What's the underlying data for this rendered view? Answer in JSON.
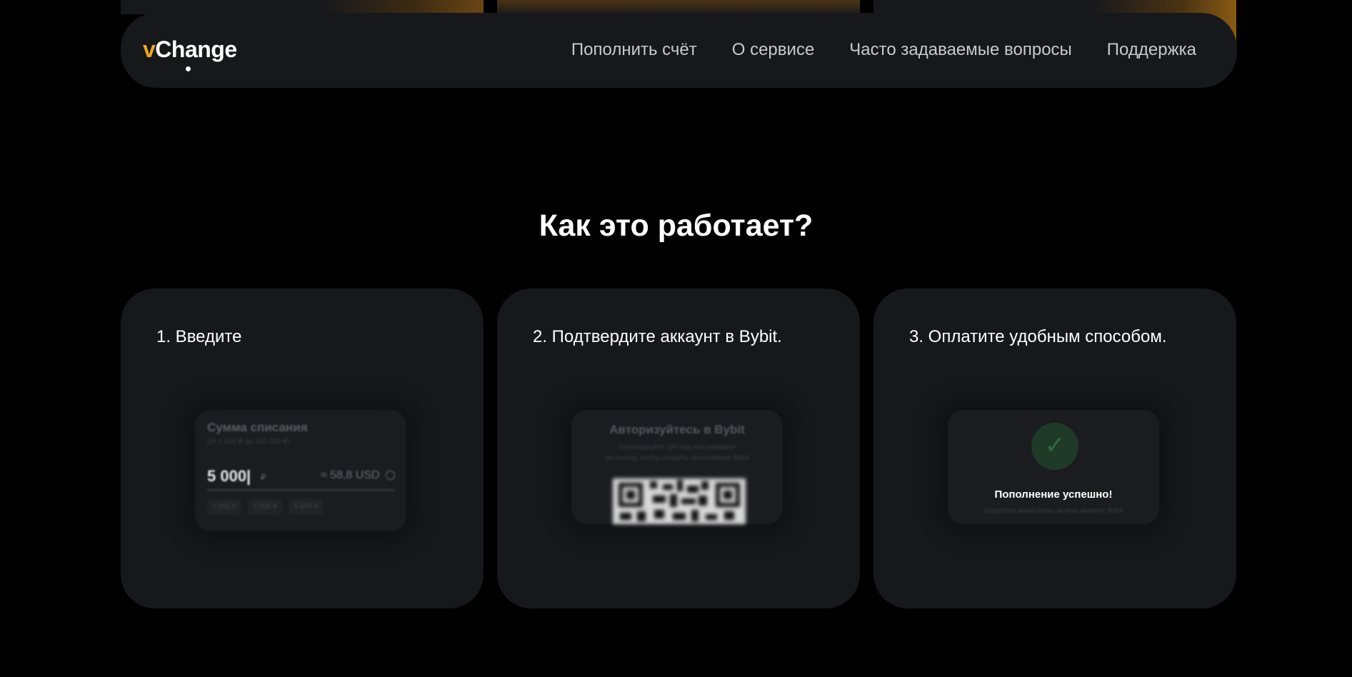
{
  "header": {
    "logo_v": "v",
    "logo_rest": "Change",
    "nav": [
      {
        "label": "Пополнить счёт"
      },
      {
        "label": "О сервисе"
      },
      {
        "label": "Часто задаваемые вопросы"
      },
      {
        "label": "Поддержка"
      }
    ]
  },
  "section": {
    "title": "Как это работает?"
  },
  "steps": [
    {
      "title": "1. Введите",
      "preview": {
        "label": "Сумма списания",
        "sub": "(от 1 000 ₽ до 100 000 ₽)",
        "amount": "5 000|",
        "currency": "₽",
        "usd": "≈ 58,8 USD",
        "chips": [
          "1 000 ₽",
          "2 500 ₽",
          "5 000 ₽"
        ]
      }
    },
    {
      "title": "2. Подтвердите аккаунт в Bybit.",
      "preview": {
        "label": "Авторизуйтесь в Bybit",
        "sub_line1": "Отсканируйте QR-код или нажмите",
        "sub_line2": "на кнопку, чтобы открыть приложение Bybit"
      }
    },
    {
      "title": "3. Оплатите удобным способом.",
      "preview": {
        "label": "Пополнение успешно!",
        "sub": "Средства зачислены на ваш аккаунт Bybit"
      }
    }
  ],
  "colors": {
    "accent": "#f0a91b",
    "card_bg": "#17181c",
    "page_bg": "#000000"
  },
  "icons": {
    "check": "check-icon",
    "qr": "qr-code-icon",
    "info": "info-icon"
  }
}
